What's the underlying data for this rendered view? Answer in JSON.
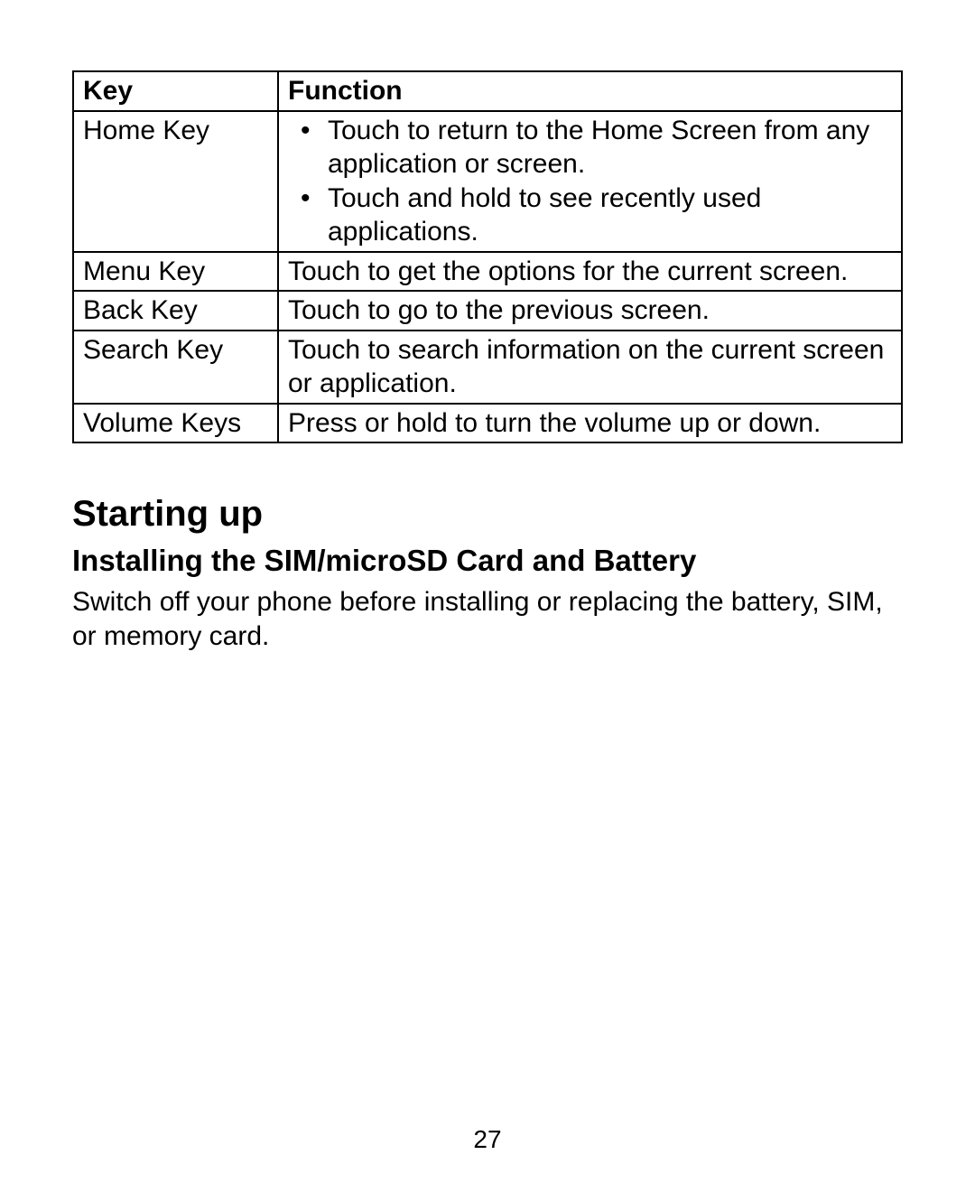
{
  "table": {
    "header": {
      "key": "Key",
      "function": "Function"
    },
    "rows": [
      {
        "key": "Home Key",
        "bullets": [
          "Touch to return to the Home Screen from any application or screen.",
          "Touch and hold to see recently used applications."
        ]
      },
      {
        "key": "Menu Key",
        "text": "Touch to get the options for the current screen."
      },
      {
        "key": "Back Key",
        "text": "Touch to go to the previous screen."
      },
      {
        "key": "Search Key",
        "text": "Touch to search information on the current screen or application."
      },
      {
        "key": "Volume Keys",
        "text": "Press or hold to turn the volume up or down."
      }
    ]
  },
  "section_title": "Starting up",
  "subsection_title": "Installing the SIM/microSD Card and Battery",
  "body_text": "Switch off your phone before installing or replacing the battery, SIM, or memory card.",
  "page_number": "27"
}
